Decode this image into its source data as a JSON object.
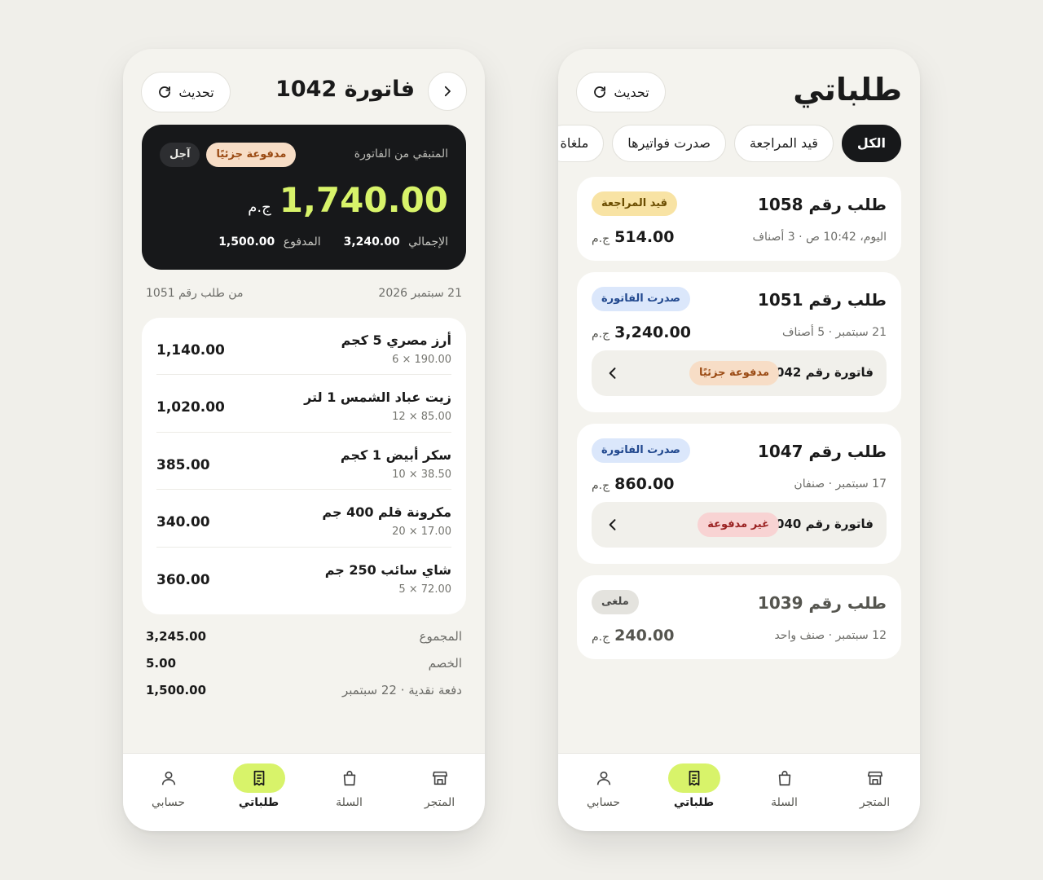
{
  "invoice_screen": {
    "title": "فاتورة 1042",
    "refresh_label": "تحديث",
    "summary": {
      "remaining_label": "المتبقي من الفاتورة",
      "status_badge": "مدفوعة جزئيًا",
      "term_badge": "آجل",
      "amount": "1,740.00",
      "currency": "ج.م",
      "total_label": "الإجمالي",
      "total_value": "3,240.00",
      "paid_label": "المدفوع",
      "paid_value": "1,500.00"
    },
    "date": "21 سبتمبر 2026",
    "from_order": "من طلب رقم 1051",
    "items": [
      {
        "name": "أرز مصري 5 كجم",
        "qty": "6 × 190.00",
        "total": "1,140.00"
      },
      {
        "name": "زيت عباد الشمس 1 لتر",
        "qty": "12 × 85.00",
        "total": "1,020.00"
      },
      {
        "name": "سكر أبيض 1 كجم",
        "qty": "10 × 38.50",
        "total": "385.00"
      },
      {
        "name": "مكرونة قلم 400 جم",
        "qty": "20 × 17.00",
        "total": "340.00"
      },
      {
        "name": "شاي سائب 250 جم",
        "qty": "5 × 72.00",
        "total": "360.00"
      }
    ],
    "subtotal_label": "المجموع",
    "subtotal_value": "3,245.00",
    "discount_label": "الخصم",
    "discount_value": "5.00",
    "payment_label": "دفعة نقدية · 22 سبتمبر",
    "payment_value": "1,500.00"
  },
  "orders_screen": {
    "title": "طلباتي",
    "refresh_label": "تحديث",
    "filters": [
      "الكل",
      "قيد المراجعة",
      "صدرت فواتيرها",
      "ملغاة"
    ],
    "orders": [
      {
        "title": "طلب رقم 1058",
        "subtitle": "اليوم، 10:42 ص · 3 أصناف",
        "badge": "قيد المراجعة",
        "amount": "514.00",
        "currency": "ج.م"
      },
      {
        "title": "طلب رقم 1051",
        "subtitle": "21 سبتمبر · 5 أصناف",
        "badge": "صدرت الفاتورة",
        "amount": "3,240.00",
        "currency": "ج.م",
        "invoice": {
          "label": "فاتورة رقم 1042",
          "badge": "مدفوعة جزئيًا"
        }
      },
      {
        "title": "طلب رقم 1047",
        "subtitle": "17 سبتمبر · صنفان",
        "badge": "صدرت الفاتورة",
        "amount": "860.00",
        "currency": "ج.م",
        "invoice": {
          "label": "فاتورة رقم 1040",
          "badge": "غير مدفوعة"
        }
      },
      {
        "title": "طلب رقم 1039",
        "subtitle": "12 سبتمبر · صنف واحد",
        "badge": "ملغى",
        "amount": "240.00",
        "currency": "ج.م"
      }
    ]
  },
  "nav": {
    "items": [
      {
        "label": "المتجر",
        "icon": "store-icon"
      },
      {
        "label": "السلة",
        "icon": "bag-icon"
      },
      {
        "label": "طلباتي",
        "icon": "receipt-icon"
      },
      {
        "label": "حسابي",
        "icon": "user-icon"
      }
    ],
    "active": "طلباتي"
  },
  "colors": {
    "accent": "#d8f36a",
    "dark_card": "#17181a",
    "background": "#f0efea"
  }
}
